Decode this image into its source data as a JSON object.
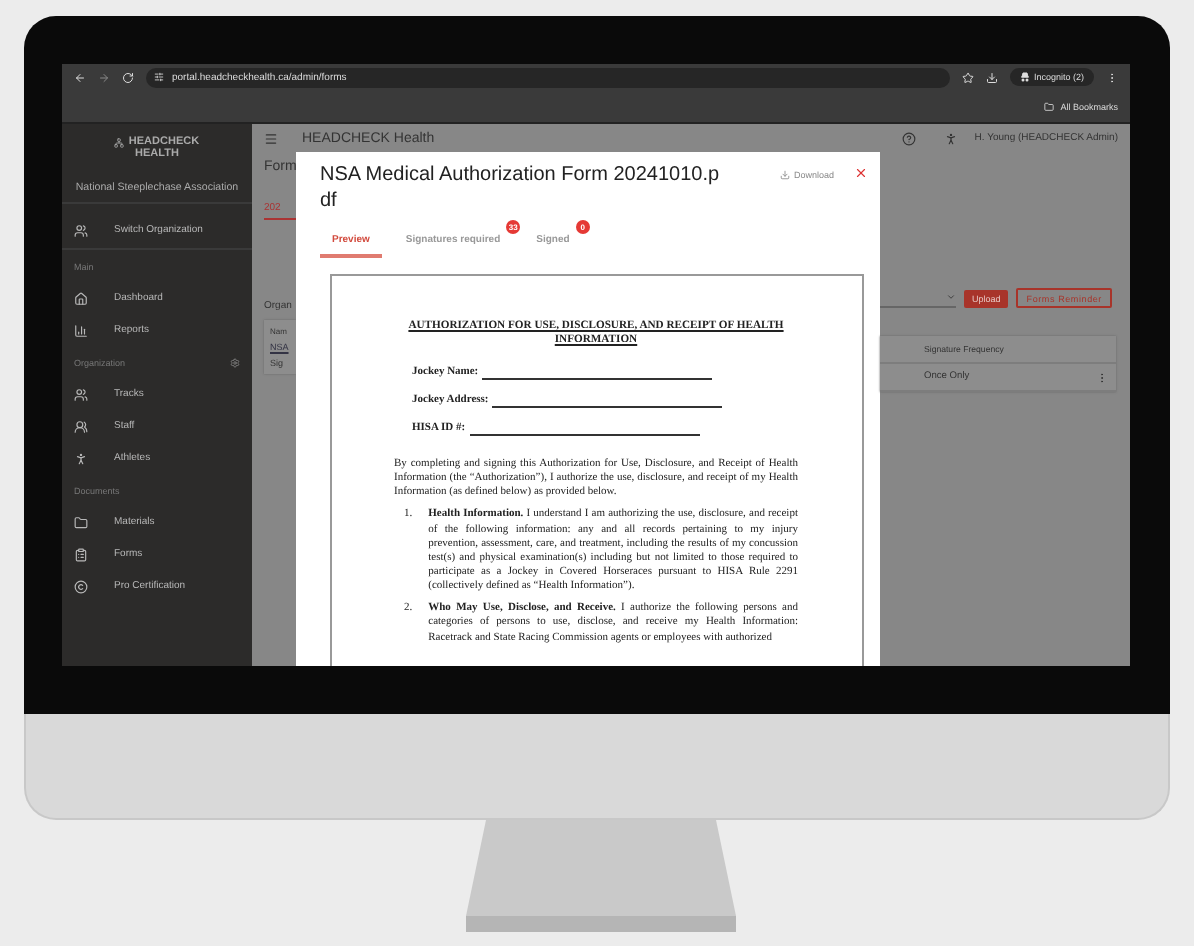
{
  "browser": {
    "url": "portal.headcheckhealth.ca/admin/forms",
    "profile": "Incognito (2)",
    "bookmarks": "All Bookmarks"
  },
  "sidebar": {
    "logo": [
      "HEADCHECK",
      "HEALTH"
    ],
    "organization": "National Steeplechase Association",
    "switch_label": "Switch Organization",
    "sections": [
      {
        "title": "Main",
        "settings": false,
        "items": [
          {
            "label": "Dashboard",
            "kind": "home"
          },
          {
            "label": "Reports",
            "kind": "chart"
          }
        ]
      },
      {
        "title": "Organization",
        "settings": true,
        "items": [
          {
            "label": "Tracks",
            "kind": "group"
          },
          {
            "label": "Staff",
            "kind": "pair"
          },
          {
            "label": "Athletes",
            "kind": "person"
          }
        ]
      },
      {
        "title": "Documents",
        "settings": false,
        "items": [
          {
            "label": "Materials",
            "kind": "folder"
          },
          {
            "label": "Forms",
            "kind": "clipboard"
          },
          {
            "label": "Pro Certification",
            "kind": "copyright"
          }
        ]
      }
    ]
  },
  "header": {
    "app_title": "HEADCHECK Health",
    "user": "H. Young (HEADCHECK Admin)"
  },
  "page_left": {
    "title": "Form",
    "tab": "202",
    "section": "Organ",
    "column": "Nam",
    "link": "NSA",
    "sub": "Sig"
  },
  "page_right": {
    "upload": "Upload",
    "reminder": "Forms Reminder",
    "column": "Signature Frequency",
    "cell": "Once Only"
  },
  "modal": {
    "title": "NSA Medical Authorization Form 20241010.pdf",
    "download": "Download",
    "tabs": [
      {
        "label": "Preview",
        "selected": true
      },
      {
        "label": "Signatures required",
        "selected": false,
        "badge": "33"
      },
      {
        "label": "Signed",
        "selected": false,
        "badge": "0"
      }
    ],
    "document": {
      "heading": "AUTHORIZATION FOR USE, DISCLOSURE, AND RECEIPT OF HEALTH INFORMATION",
      "fields": [
        "Jockey Name:",
        "Jockey Address:",
        "HISA ID #:"
      ],
      "intro": "By completing and signing this Authorization for Use, Disclosure, and Receipt of Health Information (the “Authorization”), I authorize the use, disclosure, and receipt of my Health Information (as defined below) as provided below.",
      "items": [
        {
          "number": "1.",
          "text": "**Health Information.**  I understand I am authorizing the use, disclosure, and receipt of the following information:  any and all records pertaining to my injury prevention, assessment, care, and treatment, including the results of my concussion test(s) and physical examination(s) including but not limited to those required to participate as a Jockey in Covered Horseraces pursuant to HISA Rule 2291 (collectively defined as “Health Information”)."
        },
        {
          "number": "2.",
          "text": "**Who May Use, Disclose, and Receive.**  I authorize the following persons and categories of persons to use, disclose, and receive my Health Information: Racetrack and State Racing Commission agents or employees with authorized"
        }
      ]
    }
  }
}
